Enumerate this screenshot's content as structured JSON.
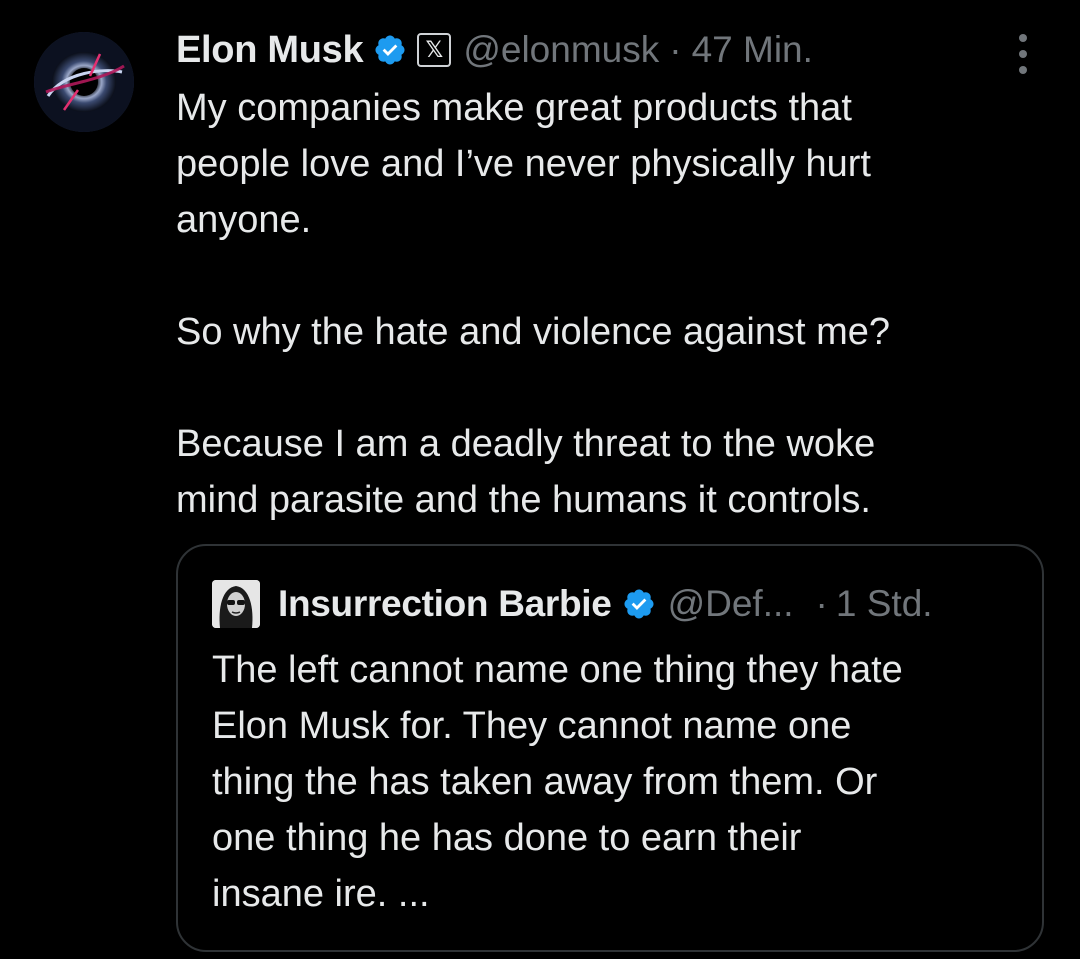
{
  "tweet": {
    "display_name": "Elon Musk",
    "verified_icon": "verified-badge-icon",
    "affiliation_icon": "x-logo-icon",
    "affiliation_glyph": "𝕏",
    "handle": "@elonmusk",
    "separator": "·",
    "time": "47 Min.",
    "more_icon": "more-options-icon",
    "text": "My companies make great products that\npeople love and I’ve never physically hurt\nanyone.\n\nSo why the hate and violence against me?\n\nBecause I am a deadly threat to the woke\nmind parasite and the humans it controls."
  },
  "quoted_tweet": {
    "display_name": "Insurrection Barbie",
    "verified_icon": "verified-badge-icon",
    "handle": "@Def...",
    "separator": "·",
    "time": "1 Std.",
    "text": "The left cannot name one thing they hate\nElon Musk for. They cannot name one\nthing the has taken away from them. Or\none thing he has done to earn their\ninsane ire. ..."
  },
  "colors": {
    "background": "#000000",
    "primary_text": "#e7e9ea",
    "secondary_text": "#71767b",
    "verified_blue": "#1d9bf0",
    "border": "#2f3336"
  }
}
